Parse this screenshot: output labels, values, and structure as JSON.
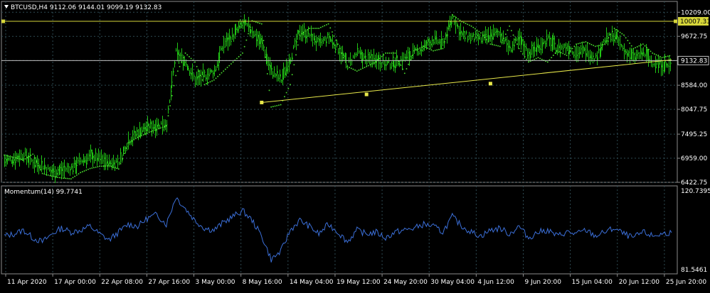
{
  "header": {
    "symbol_line": "BTCUSD,H4  9112.06 9144.01 9099.19 9132.83",
    "indicator_line": "Momentum(14) 99.7741"
  },
  "colors": {
    "background": "#000000",
    "grid": "#2e4a52",
    "frame": "#8c8c8c",
    "bars": "#21c415",
    "parabolic_sar": "#47d62c",
    "momentum": "#3b6fd8",
    "trendline": "#e8e84a",
    "horizontal_level": "#d6d63a",
    "current_price": "#c0c0c0",
    "text": "#ffffff"
  },
  "chart_data": [
    {
      "type": "bar",
      "pane": "price",
      "symbol": "BTCUSD",
      "timeframe": "H4",
      "ohlc_current": {
        "open": 9112.06,
        "high": 9144.01,
        "low": 9099.19,
        "close": 9132.83
      },
      "ylim": [
        6422.75,
        10450
      ],
      "y_ticks": [
        "10209.00",
        "9672.75",
        "9132.83",
        "8584.00",
        "8047.75",
        "7495.25",
        "6959.00",
        "6422.75"
      ],
      "y_tick_values": [
        10209.0,
        9672.75,
        9132.83,
        8584.0,
        8047.75,
        7495.25,
        6959.0,
        6422.75
      ],
      "x_tick_labels": [
        "11 Apr 2020",
        "17 Apr 00:00",
        "22 Apr 08:00",
        "27 Apr 16:00",
        "3 May 00:00",
        "8 May 16:00",
        "14 May 04:00",
        "19 May 12:00",
        "24 May 20:00",
        "30 May 04:00",
        "4 Jun 12:00",
        "9 Jun 20:00",
        "15 Jun 04:00",
        "20 Jun 12:00",
        "25 Jun 20:00"
      ],
      "price_path": [
        [
          0,
          6900
        ],
        [
          1,
          6950
        ],
        [
          2,
          7050
        ],
        [
          3,
          6880
        ],
        [
          4,
          6800
        ],
        [
          5,
          6650
        ],
        [
          6,
          6700
        ],
        [
          7,
          6750
        ],
        [
          8,
          6900
        ],
        [
          9,
          7000
        ],
        [
          10,
          6950
        ],
        [
          11,
          6850
        ],
        [
          12,
          6900
        ],
        [
          13,
          7350
        ],
        [
          14,
          7550
        ],
        [
          15,
          7650
        ],
        [
          16,
          7700
        ],
        [
          17,
          7750
        ],
        [
          18,
          9300
        ],
        [
          19,
          9100
        ],
        [
          20,
          8700
        ],
        [
          21,
          8800
        ],
        [
          22,
          8900
        ],
        [
          23,
          9500
        ],
        [
          24,
          9700
        ],
        [
          25,
          9950
        ],
        [
          26,
          9800
        ],
        [
          27,
          9500
        ],
        [
          28,
          8900
        ],
        [
          29,
          8700
        ],
        [
          30,
          9200
        ],
        [
          31,
          9800
        ],
        [
          32,
          9700
        ],
        [
          33,
          9500
        ],
        [
          34,
          9650
        ],
        [
          35,
          9400
        ],
        [
          36,
          9050
        ],
        [
          37,
          9300
        ],
        [
          38,
          9150
        ],
        [
          39,
          9200
        ],
        [
          40,
          9050
        ],
        [
          41,
          9100
        ],
        [
          42,
          9200
        ],
        [
          43,
          9300
        ],
        [
          44,
          9450
        ],
        [
          45,
          9600
        ],
        [
          46,
          9500
        ],
        [
          47,
          10100
        ],
        [
          48,
          9700
        ],
        [
          49,
          9650
        ],
        [
          50,
          9600
        ],
        [
          51,
          9700
        ],
        [
          52,
          9750
        ],
        [
          53,
          9400
        ],
        [
          54,
          9600
        ],
        [
          55,
          9300
        ],
        [
          56,
          9450
        ],
        [
          57,
          9600
        ],
        [
          58,
          9400
        ],
        [
          59,
          9450
        ],
        [
          60,
          9300
        ],
        [
          61,
          9350
        ],
        [
          62,
          9200
        ],
        [
          63,
          9600
        ],
        [
          64,
          9700
        ],
        [
          65,
          9350
        ],
        [
          66,
          9200
        ],
        [
          67,
          9300
        ],
        [
          68,
          9100
        ],
        [
          69,
          9050
        ],
        [
          70,
          9000
        ]
      ],
      "parabolic_sar": [
        [
          0,
          7030
        ],
        [
          1,
          6980
        ],
        [
          2,
          6920
        ],
        [
          3,
          7050
        ],
        [
          4,
          6620
        ],
        [
          5,
          6560
        ],
        [
          6,
          6520
        ],
        [
          7,
          6500
        ],
        [
          8,
          6640
        ],
        [
          9,
          6730
        ],
        [
          10,
          6780
        ],
        [
          11,
          6790
        ],
        [
          12,
          6720
        ],
        [
          13,
          7300
        ],
        [
          14,
          7420
        ],
        [
          15,
          7520
        ],
        [
          16,
          7600
        ],
        [
          17,
          7680
        ],
        [
          18,
          8800
        ],
        [
          19,
          9300
        ],
        [
          20,
          9100
        ],
        [
          21,
          8600
        ],
        [
          22,
          8700
        ],
        [
          23,
          8900
        ],
        [
          24,
          9100
        ],
        [
          25,
          9300
        ],
        [
          26,
          10020
        ],
        [
          27,
          9950
        ],
        [
          28,
          8100
        ],
        [
          29,
          8150
        ],
        [
          30,
          8600
        ],
        [
          31,
          9700
        ],
        [
          32,
          9850
        ],
        [
          33,
          9850
        ],
        [
          34,
          9950
        ],
        [
          35,
          9500
        ],
        [
          36,
          9000
        ],
        [
          37,
          8900
        ],
        [
          38,
          9000
        ],
        [
          39,
          9100
        ],
        [
          40,
          9300
        ],
        [
          41,
          9300
        ],
        [
          42,
          8850
        ],
        [
          43,
          9350
        ],
        [
          44,
          9450
        ],
        [
          45,
          9350
        ],
        [
          46,
          9400
        ],
        [
          47,
          10150
        ],
        [
          48,
          10000
        ],
        [
          49,
          9900
        ],
        [
          50,
          9750
        ],
        [
          51,
          9500
        ],
        [
          52,
          9450
        ],
        [
          53,
          9900
        ],
        [
          54,
          9400
        ],
        [
          55,
          9100
        ],
        [
          56,
          9200
        ],
        [
          57,
          9100
        ],
        [
          58,
          9350
        ],
        [
          59,
          9250
        ],
        [
          60,
          9500
        ],
        [
          61,
          9550
        ],
        [
          62,
          9450
        ],
        [
          63,
          9500
        ],
        [
          64,
          9850
        ],
        [
          65,
          9700
        ],
        [
          66,
          9400
        ],
        [
          67,
          9500
        ],
        [
          68,
          9300
        ],
        [
          69,
          9200
        ],
        [
          70,
          9250
        ]
      ],
      "n_periods": 71,
      "horizontal_level": 10007.31,
      "horizontal_level_label": "10007.31",
      "current_price": 9132.83,
      "current_price_label": "9132.83",
      "trendline": {
        "start": [
          27,
          8200
        ],
        "end": [
          70,
          9150
        ],
        "anchors": [
          [
            27,
            8200
          ],
          [
            38,
            8380
          ],
          [
            51,
            8620
          ]
        ]
      }
    },
    {
      "type": "line",
      "pane": "indicator",
      "name": "Momentum(14)",
      "last_value": 99.7741,
      "ylim": [
        81.5461,
        120.7395
      ],
      "y_ticks": [
        "120.7395",
        "81.5461"
      ],
      "y_tick_values": [
        120.7395,
        81.5461
      ],
      "values": [
        98,
        99,
        101,
        97,
        95,
        99,
        102,
        100,
        101,
        103,
        99,
        96,
        100,
        104,
        103,
        107,
        109,
        104,
        118,
        112,
        106,
        102,
        101,
        105,
        108,
        111,
        106,
        98,
        86,
        90,
        101,
        106,
        103,
        99,
        104,
        100,
        95,
        101,
        99,
        100,
        97,
        100,
        101,
        102,
        104,
        103,
        100,
        108,
        103,
        100,
        98,
        101,
        102,
        99,
        103,
        97,
        100,
        101,
        98,
        100,
        99,
        101,
        98,
        100,
        102,
        99,
        97,
        100,
        98,
        99,
        100
      ]
    }
  ]
}
